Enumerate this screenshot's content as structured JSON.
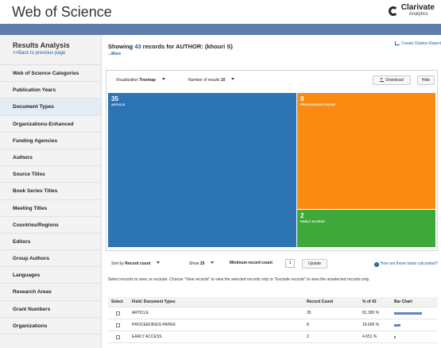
{
  "header": {
    "app_title": "Web of Science",
    "brand_name": "Clarivate",
    "brand_sub": "Analytics"
  },
  "sidebar": {
    "title": "Results Analysis",
    "back_link": "<<Back to previous page",
    "items": [
      {
        "label": "Web of Science Categories",
        "active": false
      },
      {
        "label": "Publication Years",
        "active": false
      },
      {
        "label": "Document Types",
        "active": true
      },
      {
        "label": "Organizations-Enhanced",
        "active": false
      },
      {
        "label": "Funding Agencies",
        "active": false
      },
      {
        "label": "Authors",
        "active": false
      },
      {
        "label": "Source Titles",
        "active": false
      },
      {
        "label": "Book Series Titles",
        "active": false
      },
      {
        "label": "Meeting Titles",
        "active": false
      },
      {
        "label": "Countries/Regions",
        "active": false
      },
      {
        "label": "Editors",
        "active": false
      },
      {
        "label": "Group Authors",
        "active": false
      },
      {
        "label": "Languages",
        "active": false
      },
      {
        "label": "Research Areas",
        "active": false
      },
      {
        "label": "Grant Numbers",
        "active": false
      },
      {
        "label": "Organizations",
        "active": false
      }
    ]
  },
  "main": {
    "showing_prefix": "Showing",
    "record_count": "43",
    "showing_suffix": "records for AUTHOR: (khouri S)",
    "more_link": "...More",
    "citation_link": "Create Citation Report"
  },
  "visualization": {
    "type_label": "Visualization",
    "type_value": "Treemap",
    "results_label": "Number of results",
    "results_value": "10",
    "download_label": "Download",
    "hide_label": "Hide",
    "tiles": [
      {
        "count": "35",
        "label": "ARTICLE",
        "color": "#2d74b5"
      },
      {
        "count": "8",
        "label": "PROCEEDINGS PAPER",
        "color": "#fa8a12"
      },
      {
        "count": "2",
        "label": "EARLY ACCESS",
        "color": "#3ea83a"
      }
    ]
  },
  "controls": {
    "sort_label": "Sort by",
    "sort_value": "Record count",
    "show_label": "Show",
    "show_value": "25",
    "min_label": "Minimum record count",
    "min_value": "1",
    "update_label": "Update",
    "help_link": "How are these totals calculated?",
    "instructions": "Select records to view, or exclude. Choose \"View records\" to view the selected records only or \"Exclude records\" to view the unselected records only."
  },
  "table": {
    "headers": {
      "select": "Select",
      "field": "Field: Document Types",
      "count": "Record Count",
      "pct": "% of 43",
      "bar": "Bar Chart"
    },
    "rows": [
      {
        "field": "ARTICLE",
        "count": "35",
        "pct": "81.395 %",
        "fraction": 0.81395
      },
      {
        "field": "PROCEEDINGS PAPER",
        "count": "8",
        "pct": "18.605 %",
        "fraction": 0.18605
      },
      {
        "field": "EARLY ACCESS",
        "count": "2",
        "pct": "4.651 %",
        "fraction": 0.04651
      }
    ]
  }
}
